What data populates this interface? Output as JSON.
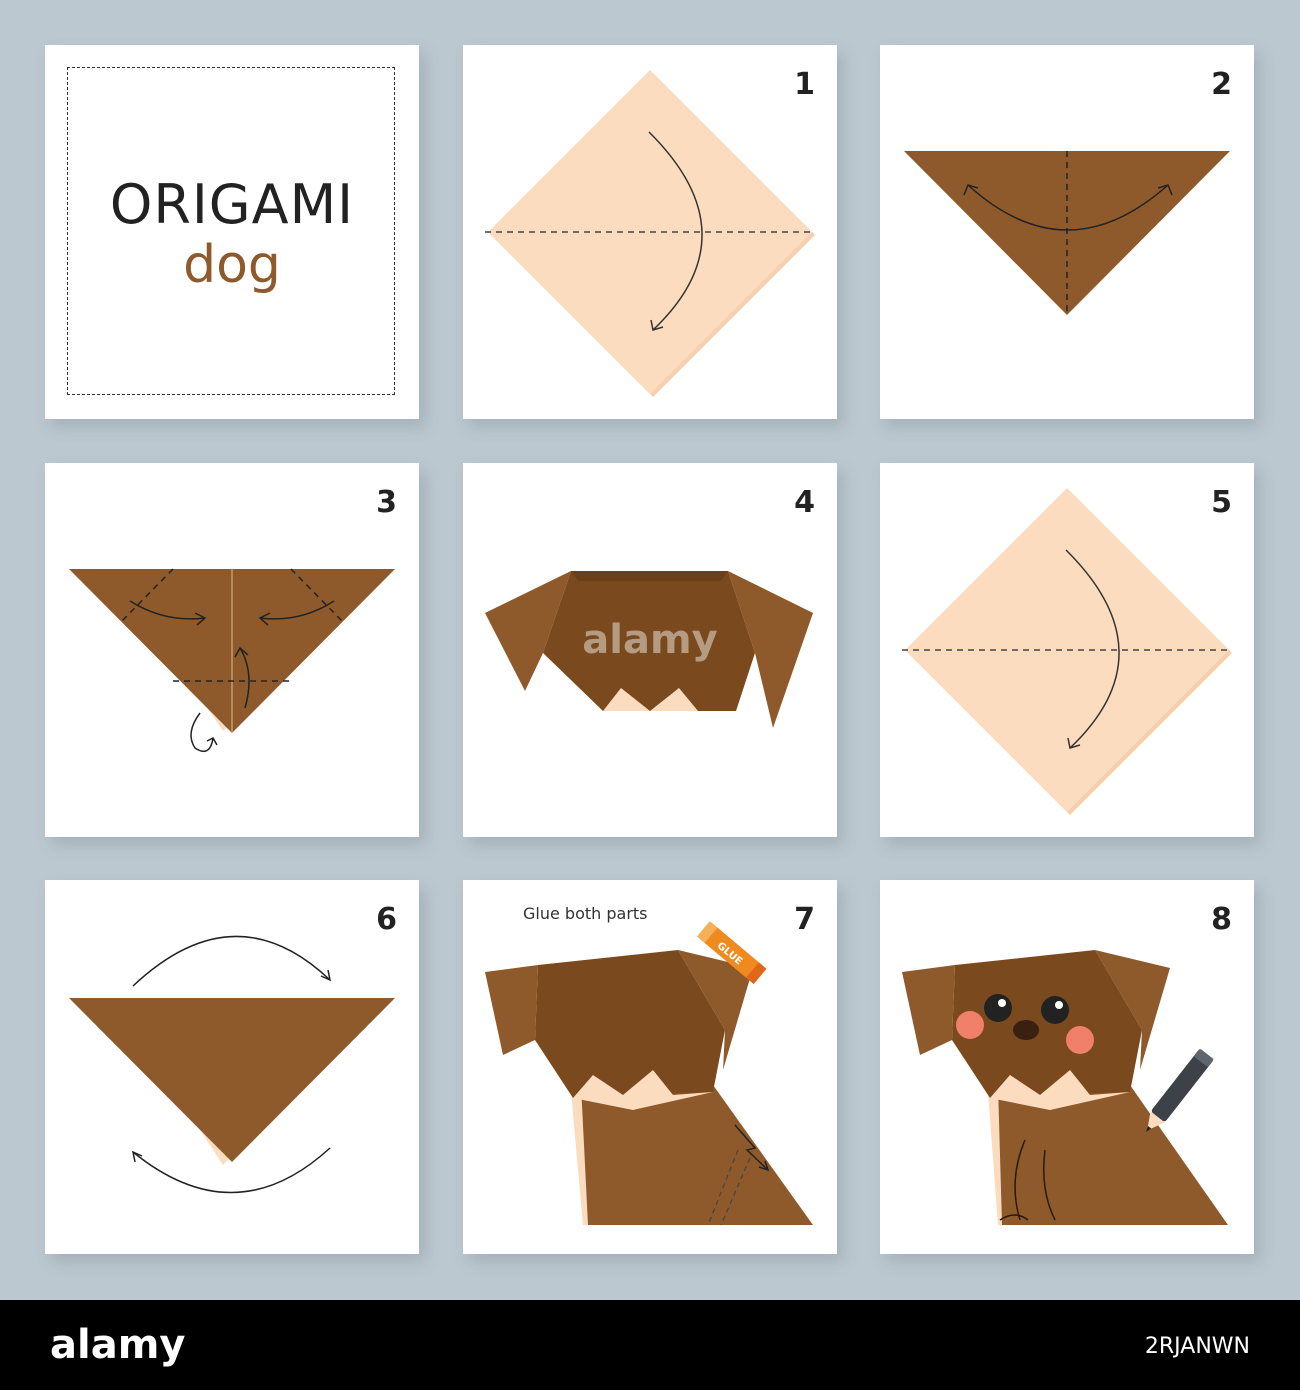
{
  "title": {
    "main": "ORIGAMI",
    "sub": "dog"
  },
  "steps": [
    {
      "number": "1"
    },
    {
      "number": "2"
    },
    {
      "number": "3"
    },
    {
      "number": "4",
      "watermark": "alamy"
    },
    {
      "number": "5"
    },
    {
      "number": "6"
    },
    {
      "number": "7",
      "note": "Glue both parts",
      "glue_label": "GLUE"
    },
    {
      "number": "8"
    }
  ],
  "footer": {
    "logo": "alamy",
    "image_id": "2RJANWN"
  },
  "colors": {
    "background": "#bcc8d0",
    "paper_light": "#fcdcbf",
    "paper_brown": "#8e5a2b",
    "paper_dark_brown": "#7a4a1e",
    "title_accent": "#8e5a2b",
    "cheek": "#f0806a",
    "glue": "#f08a1e"
  }
}
